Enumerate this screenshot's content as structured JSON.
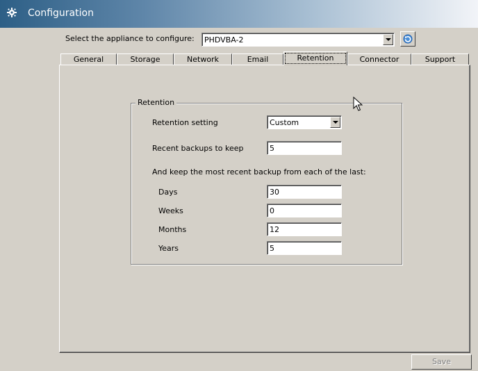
{
  "window": {
    "title": "Configuration",
    "icon": "gear-icon"
  },
  "appliance": {
    "label": "Select the appliance to configure:",
    "selected": "PHDVBA-2",
    "refresh_icon": "refresh-icon"
  },
  "tabs": [
    {
      "label": "General"
    },
    {
      "label": "Storage"
    },
    {
      "label": "Network"
    },
    {
      "label": "Email"
    },
    {
      "label": "Retention"
    },
    {
      "label": "Connector"
    },
    {
      "label": "Support"
    }
  ],
  "active_tab": "Retention",
  "retention": {
    "group_title": "Retention",
    "setting_label": "Retention setting",
    "setting_value": "Custom",
    "recent_label": "Recent backups to keep",
    "recent_value": "5",
    "keep_note": "And keep the most recent backup from each of the last:",
    "days_label": "Days",
    "days_value": "30",
    "weeks_label": "Weeks",
    "weeks_value": "0",
    "months_label": "Months",
    "months_value": "12",
    "years_label": "Years",
    "years_value": "5"
  },
  "footer": {
    "save_label": "Save"
  }
}
